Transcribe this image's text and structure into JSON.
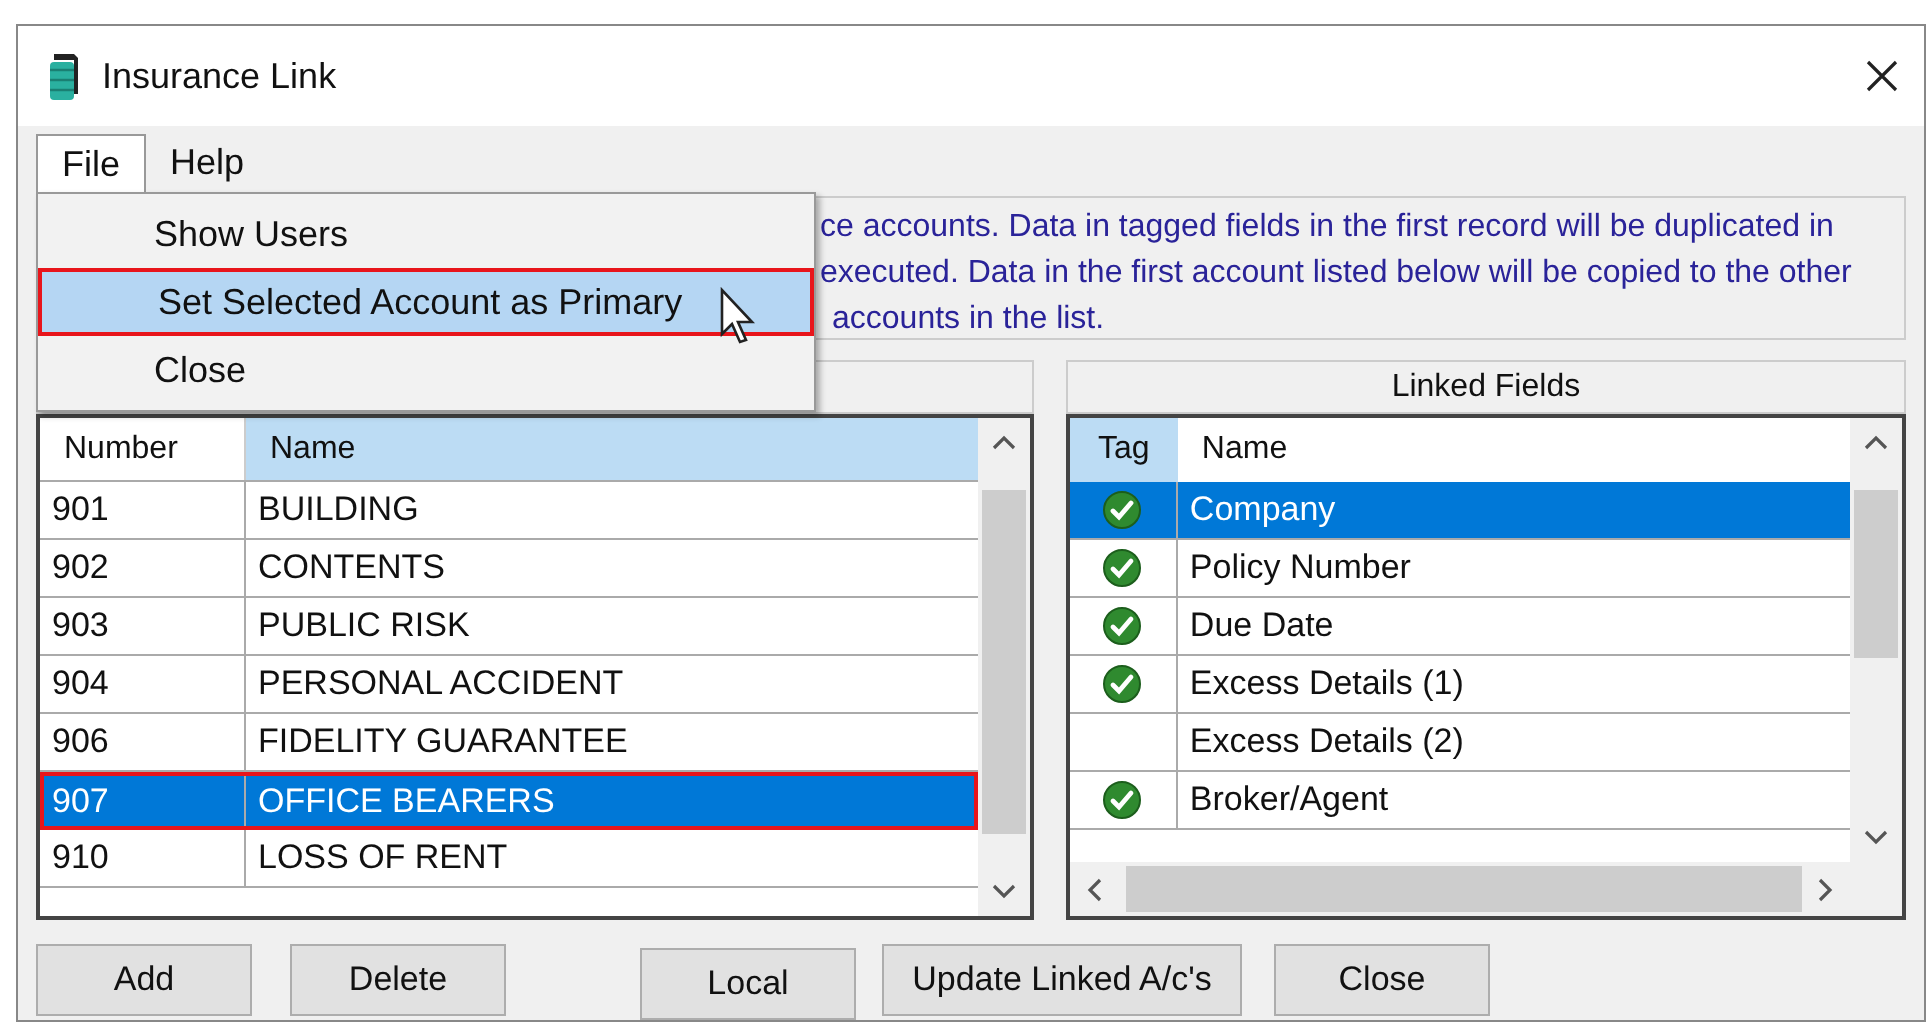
{
  "window": {
    "title": "Insurance Link"
  },
  "menu_bar": [
    {
      "label": "File",
      "selected": true
    },
    {
      "label": "Help",
      "selected": false
    }
  ],
  "file_menu": [
    {
      "label": "Show Users",
      "selected": false
    },
    {
      "label": "Set Selected Account as Primary",
      "selected": true
    },
    {
      "label": "Close",
      "selected": false
    }
  ],
  "description_lines": [
    "ce accounts. Data in tagged fields in the first record will be duplicated in",
    "executed. Data in the first account listed below will be copied to the other",
    "accounts in the list."
  ],
  "accounts": {
    "columns": [
      {
        "label": "Number",
        "selected": false
      },
      {
        "label": "Name",
        "selected": true
      }
    ],
    "rows": [
      {
        "number": "901",
        "name": "BUILDING",
        "selected": false
      },
      {
        "number": "902",
        "name": "CONTENTS",
        "selected": false
      },
      {
        "number": "903",
        "name": "PUBLIC RISK",
        "selected": false
      },
      {
        "number": "904",
        "name": "PERSONAL ACCIDENT",
        "selected": false
      },
      {
        "number": "906",
        "name": "FIDELITY GUARANTEE",
        "selected": false
      },
      {
        "number": "907",
        "name": "OFFICE BEARERS",
        "selected": true
      },
      {
        "number": "910",
        "name": "LOSS OF RENT",
        "selected": false
      }
    ]
  },
  "linked_fields": {
    "title": "Linked Fields",
    "columns": [
      {
        "label": "Tag",
        "selected": true
      },
      {
        "label": "Name",
        "selected": false
      }
    ],
    "rows": [
      {
        "tagged": true,
        "name": "Company",
        "selected": true
      },
      {
        "tagged": true,
        "name": "Policy Number",
        "selected": false
      },
      {
        "tagged": true,
        "name": "Due Date",
        "selected": false
      },
      {
        "tagged": true,
        "name": "Excess Details (1)",
        "selected": false
      },
      {
        "tagged": false,
        "name": "Excess Details (2)",
        "selected": false
      },
      {
        "tagged": true,
        "name": "Broker/Agent",
        "selected": false
      }
    ]
  },
  "buttons": [
    "Add",
    "Delete",
    "Local",
    "Update Linked A/c's",
    "Close"
  ]
}
